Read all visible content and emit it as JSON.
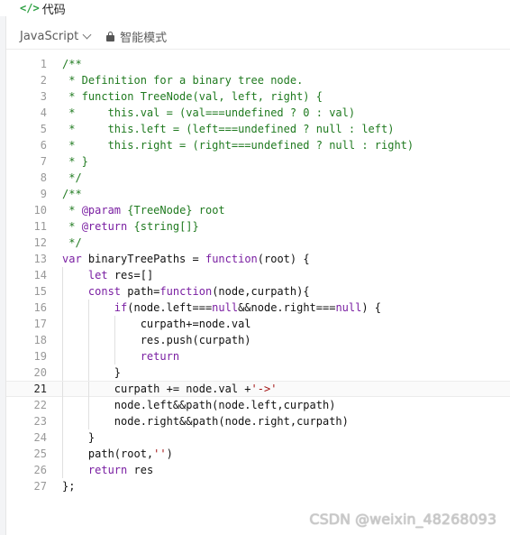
{
  "header": {
    "tab_icon": "</>",
    "tab_label": "代码"
  },
  "toolbar": {
    "language": "JavaScript",
    "mode_label": "智能模式"
  },
  "code": {
    "active_line": 21,
    "lines": [
      {
        "n": "1",
        "text": "/**",
        "cls": "comment",
        "indent": 0
      },
      {
        "n": "2",
        "text": " * Definition for a binary tree node.",
        "cls": "comment",
        "indent": 0
      },
      {
        "n": "3",
        "text": " * function TreeNode(val, left, right) {",
        "cls": "comment",
        "indent": 0
      },
      {
        "n": "4",
        "text": " *     this.val = (val===undefined ? 0 : val)",
        "cls": "comment",
        "indent": 0
      },
      {
        "n": "5",
        "text": " *     this.left = (left===undefined ? null : left)",
        "cls": "comment",
        "indent": 0
      },
      {
        "n": "6",
        "text": " *     this.right = (right===undefined ? null : right)",
        "cls": "comment",
        "indent": 0
      },
      {
        "n": "7",
        "text": " * }",
        "cls": "comment",
        "indent": 0
      },
      {
        "n": "8",
        "text": " */",
        "cls": "comment",
        "indent": 0
      },
      {
        "n": "9",
        "text": "/**",
        "cls": "comment",
        "indent": 0
      },
      {
        "n": "10",
        "text": " * @param {TreeNode} root",
        "cls": "comment",
        "indent": 0
      },
      {
        "n": "11",
        "text": " * @return {string[]}",
        "cls": "comment",
        "indent": 0
      },
      {
        "n": "12",
        "text": " */",
        "cls": "comment",
        "indent": 0
      },
      {
        "n": "13",
        "text": "var binaryTreePaths = function(root) {",
        "cls": "kw",
        "indent": 0
      },
      {
        "n": "14",
        "text": "    let res=[]",
        "cls": "kw",
        "indent": 1
      },
      {
        "n": "15",
        "text": "    const path=function(node,curpath){",
        "cls": "kw",
        "indent": 1
      },
      {
        "n": "16",
        "text": "        if(node.left===null&&node.right===null) {",
        "cls": "kw",
        "indent": 2
      },
      {
        "n": "17",
        "text": "            curpath+=node.val",
        "cls": "kw",
        "indent": 3
      },
      {
        "n": "18",
        "text": "            res.push(curpath)",
        "cls": "kw",
        "indent": 3
      },
      {
        "n": "19",
        "text": "            return",
        "cls": "kw",
        "indent": 3
      },
      {
        "n": "20",
        "text": "        }",
        "cls": "kw",
        "indent": 2
      },
      {
        "n": "21",
        "text": "        curpath += node.val +'->'",
        "cls": "kw",
        "indent": 2
      },
      {
        "n": "22",
        "text": "        node.left&&path(node.left,curpath)",
        "cls": "kw",
        "indent": 2
      },
      {
        "n": "23",
        "text": "        node.right&&path(node.right,curpath)",
        "cls": "kw",
        "indent": 2
      },
      {
        "n": "24",
        "text": "    }",
        "cls": "kw",
        "indent": 1
      },
      {
        "n": "25",
        "text": "    path(root,'')",
        "cls": "kw",
        "indent": 1
      },
      {
        "n": "26",
        "text": "    return res",
        "cls": "kw",
        "indent": 1
      },
      {
        "n": "27",
        "text": "};",
        "cls": "kw",
        "indent": 0
      }
    ]
  },
  "watermark": "CSDN @weixin_48268093"
}
